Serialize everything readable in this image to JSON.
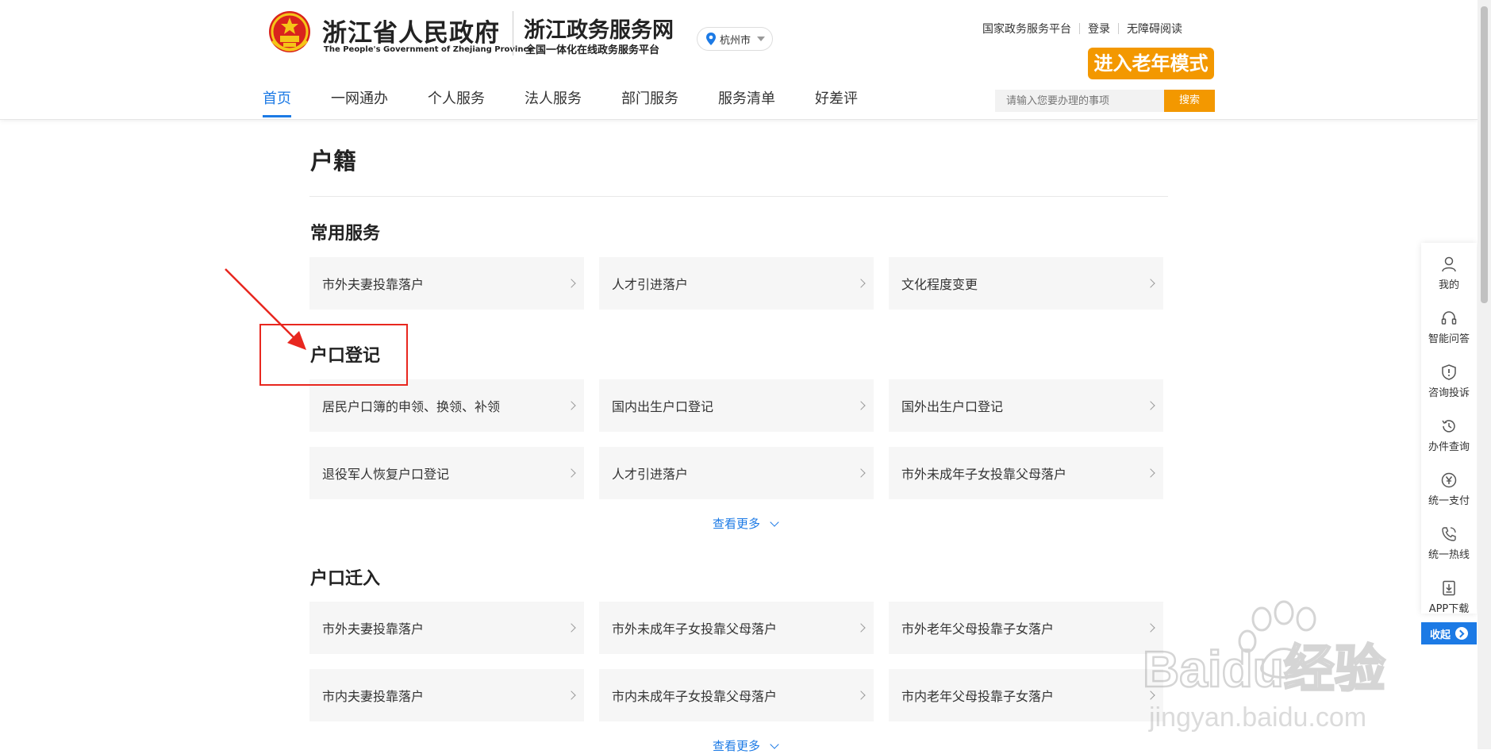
{
  "header": {
    "gov_name": "浙江省人民政府",
    "gov_name_en": "The People's Government of Zhejiang Province",
    "site_name": "浙江政务服务网",
    "site_subtitle": "全国一体化在线政务服务平台",
    "city": "杭州市",
    "top_links": [
      "国家政务服务平台",
      "登录",
      "无障碍阅读"
    ],
    "elder_mode": "进入老年模式",
    "search_placeholder": "请输入您要办理的事项",
    "search_button": "搜索"
  },
  "nav": {
    "items": [
      "首页",
      "一网通办",
      "个人服务",
      "法人服务",
      "部门服务",
      "服务清单",
      "好差评"
    ],
    "active": "首页"
  },
  "main": {
    "title": "户籍",
    "sections": [
      {
        "title": "常用服务",
        "items": [
          "市外夫妻投靠落户",
          "人才引进落户",
          "文化程度变更"
        ]
      },
      {
        "title": "户口登记",
        "items": [
          "居民户口簿的申领、换领、补领",
          "国内出生户口登记",
          "国外出生户口登记",
          "退役军人恢复户口登记",
          "人才引进落户",
          "市外未成年子女投靠父母落户"
        ],
        "more": "查看更多"
      },
      {
        "title": "户口迁入",
        "items": [
          "市外夫妻投靠落户",
          "市外未成年子女投靠父母落户",
          "市外老年父母投靠子女落户",
          "市内夫妻投靠落户",
          "市内未成年子女投靠父母落户",
          "市内老年父母投靠子女落户"
        ],
        "more": "查看更多"
      }
    ]
  },
  "sidebar": {
    "items": [
      {
        "label": "我的",
        "icon": "user-icon"
      },
      {
        "label": "智能问答",
        "icon": "headset-icon"
      },
      {
        "label": "咨询投诉",
        "icon": "shield-alert-icon"
      },
      {
        "label": "办件查询",
        "icon": "history-icon"
      },
      {
        "label": "统一支付",
        "icon": "yen-icon"
      },
      {
        "label": "统一热线",
        "icon": "phone-icon"
      },
      {
        "label": "APP下载",
        "icon": "download-icon"
      }
    ],
    "collapse": "收起"
  },
  "colors": {
    "accent_blue": "#1c7ae5",
    "accent_orange": "#f39800",
    "annotation_red": "#e8271f"
  },
  "watermark": {
    "brand": "Baidu经验",
    "url": "jingyan.baidu.com"
  }
}
